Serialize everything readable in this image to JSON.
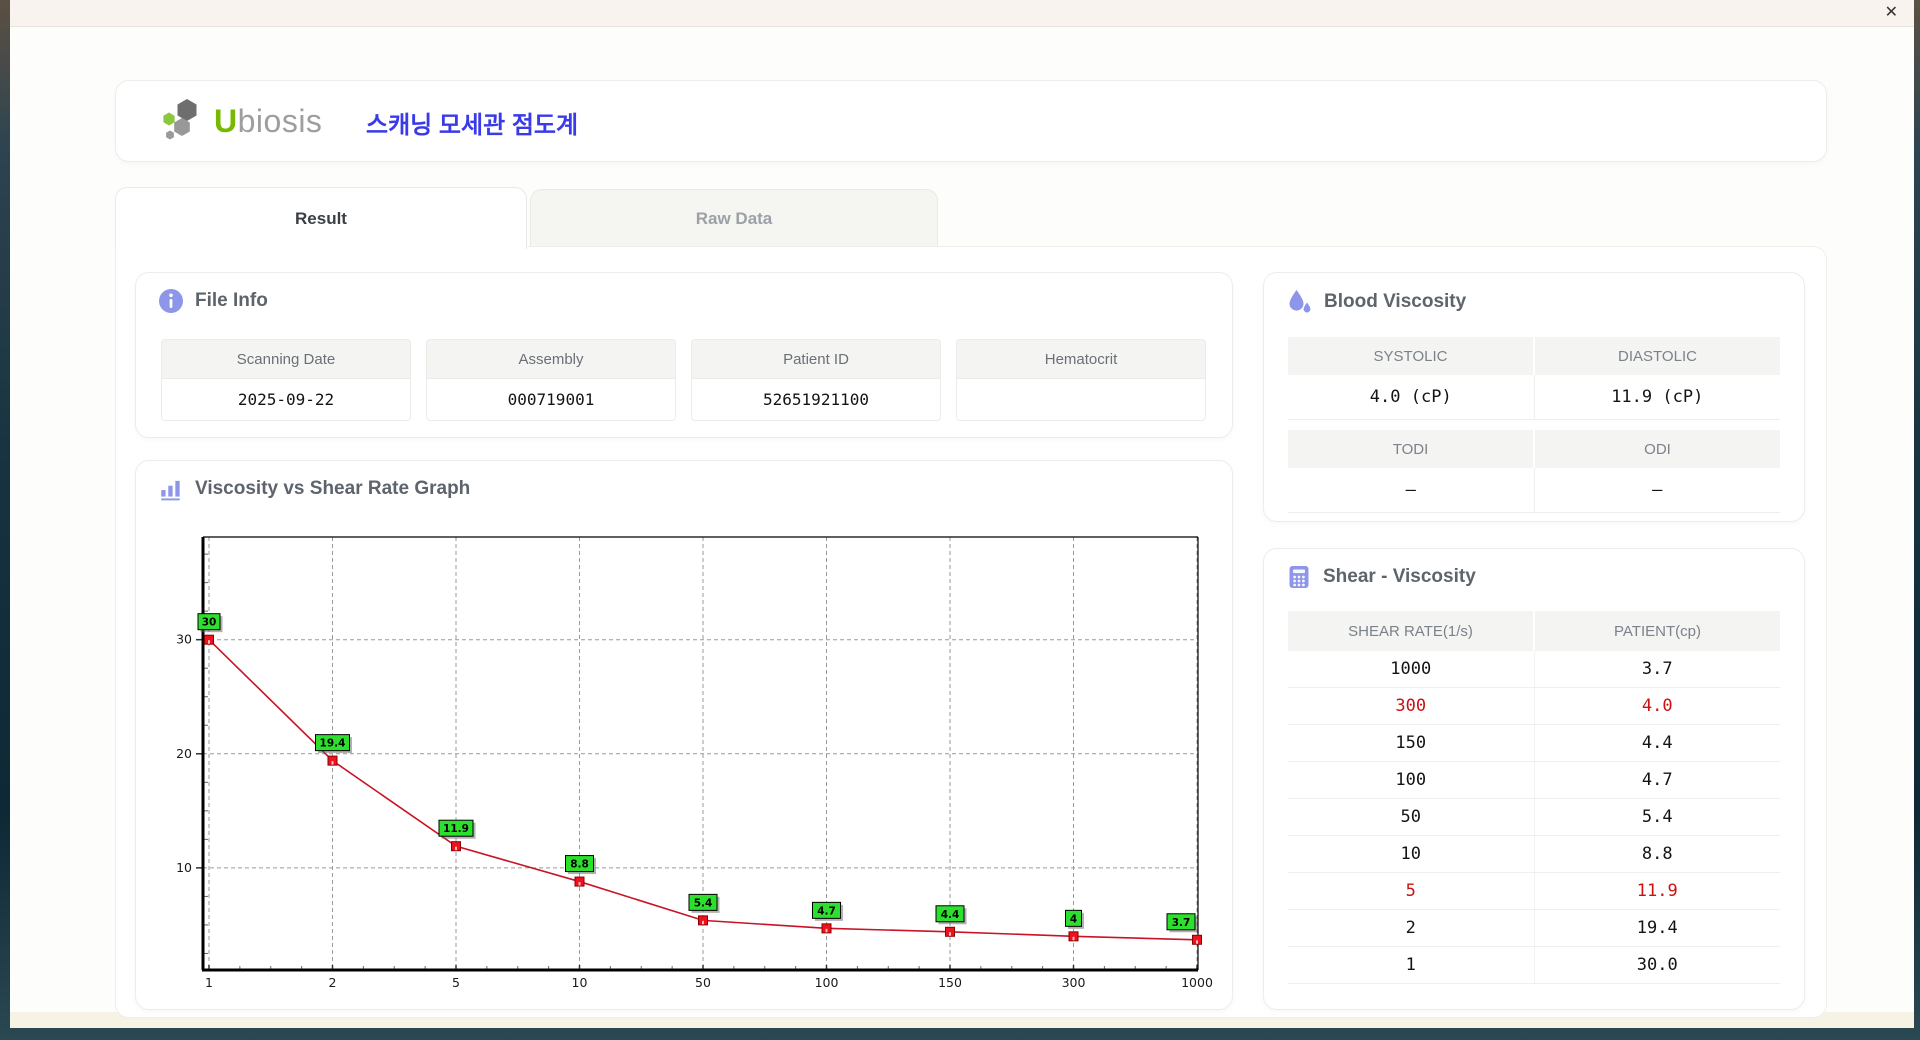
{
  "window": {
    "close": "✕"
  },
  "header": {
    "logo_u": "U",
    "logo_rest": "biosis",
    "app_title": "스캐닝 모세관 점도계"
  },
  "tabs": [
    {
      "label": "Result",
      "active": true
    },
    {
      "label": "Raw Data",
      "active": false
    }
  ],
  "file_info": {
    "title": "File Info",
    "fields": [
      {
        "label": "Scanning Date",
        "value": "2025-09-22"
      },
      {
        "label": "Assembly",
        "value": "000719001"
      },
      {
        "label": "Patient ID",
        "value": "52651921100"
      },
      {
        "label": "Hematocrit",
        "value": ""
      }
    ]
  },
  "blood_viscosity": {
    "title": "Blood Viscosity",
    "tables": [
      [
        {
          "label": "SYSTOLIC",
          "value": "4.0 (cP)"
        },
        {
          "label": "DIASTOLIC",
          "value": "11.9 (cP)"
        }
      ],
      [
        {
          "label": "TODI",
          "value": "–"
        },
        {
          "label": "ODI",
          "value": "–"
        }
      ]
    ]
  },
  "graph": {
    "title": "Viscosity vs Shear Rate Graph"
  },
  "chart_data": {
    "type": "line",
    "title": "Viscosity vs Shear Rate Graph",
    "x_categories": [
      "1",
      "2",
      "5",
      "10",
      "50",
      "100",
      "150",
      "300",
      "1000"
    ],
    "values": [
      30,
      19.4,
      11.9,
      8.8,
      5.4,
      4.7,
      4.4,
      4,
      3.7
    ],
    "point_labels": [
      "30",
      "19.4",
      "11.9",
      "8.8",
      "5.4",
      "4.7",
      "4.4",
      "4",
      "3.7"
    ],
    "y_ticks": [
      10,
      20,
      30
    ],
    "y_axis_top_value": 39,
    "y_axis_bottom_value": 1.05,
    "x_axis_type": "categorical",
    "grid": "dashed",
    "legend": "none",
    "line_color": "#c81426",
    "marker_color": "#ee1120",
    "point_label_bg": "#2ee02e"
  },
  "shear_table": {
    "title": "Shear - Viscosity",
    "columns": [
      "SHEAR RATE(1/s)",
      "PATIENT(cp)"
    ],
    "rows": [
      {
        "shear_rate": "1000",
        "patient": "3.7",
        "highlight": false
      },
      {
        "shear_rate": "300",
        "patient": "4.0",
        "highlight": true
      },
      {
        "shear_rate": "150",
        "patient": "4.4",
        "highlight": false
      },
      {
        "shear_rate": "100",
        "patient": "4.7",
        "highlight": false
      },
      {
        "shear_rate": "50",
        "patient": "5.4",
        "highlight": false
      },
      {
        "shear_rate": "10",
        "patient": "8.8",
        "highlight": false
      },
      {
        "shear_rate": "5",
        "patient": "11.9",
        "highlight": true
      },
      {
        "shear_rate": "2",
        "patient": "19.4",
        "highlight": false
      },
      {
        "shear_rate": "1",
        "patient": "30.0",
        "highlight": false
      }
    ]
  },
  "colors": {
    "accent": "#8e96ea",
    "highlight_red": "#cc1111",
    "brand_green": "#76b900",
    "brand_gray": "#9c9ea0",
    "title_blue": "#3a3ae8"
  }
}
